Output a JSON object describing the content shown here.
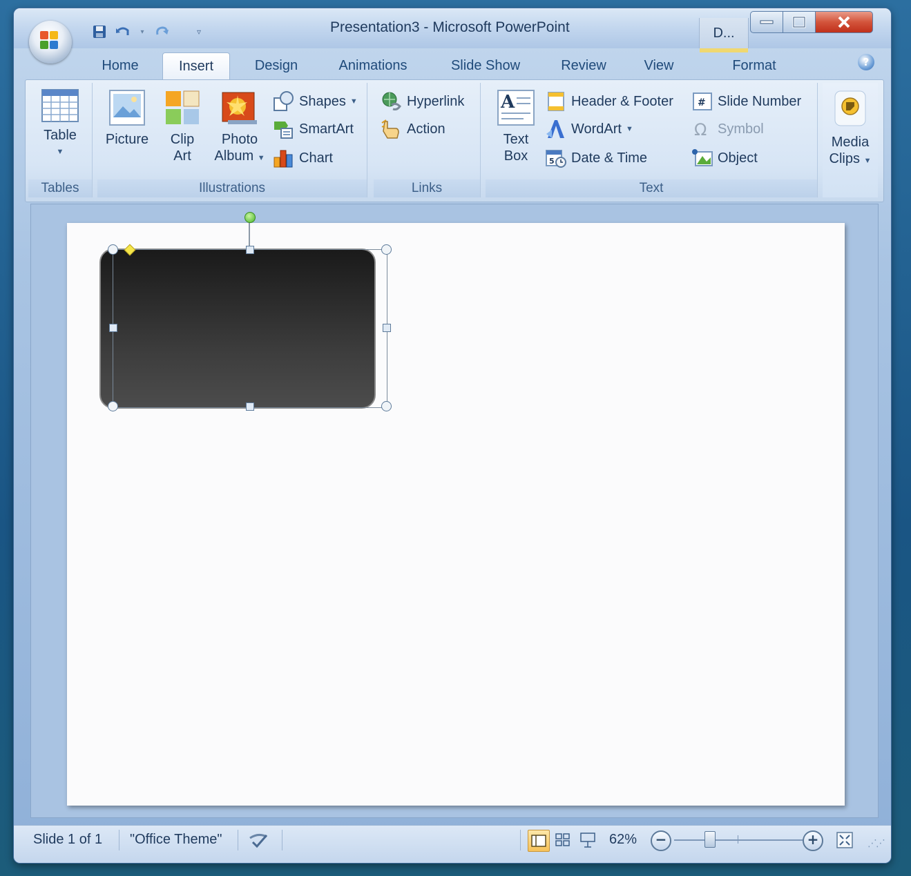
{
  "window": {
    "title": "Presentation3  -  Microsoft PowerPoint",
    "context_tab": "D...",
    "controls": {
      "minimize": "–",
      "maximize": "□",
      "close": "✕"
    }
  },
  "quick_access": [
    "save-icon",
    "undo-icon",
    "redo-icon",
    "customize-icon"
  ],
  "tabs": [
    {
      "label": "Home"
    },
    {
      "label": "Insert"
    },
    {
      "label": "Design"
    },
    {
      "label": "Animations"
    },
    {
      "label": "Slide Show"
    },
    {
      "label": "Review"
    },
    {
      "label": "View"
    },
    {
      "label": "Format"
    }
  ],
  "active_tab": "Insert",
  "ribbon": {
    "tables": {
      "label": "Tables",
      "table": "Table"
    },
    "illustrations": {
      "label": "Illustrations",
      "picture": "Picture",
      "clip_art_1": "Clip",
      "clip_art_2": "Art",
      "photo_album_1": "Photo",
      "photo_album_2": "Album",
      "shapes": "Shapes",
      "smartart": "SmartArt",
      "chart": "Chart"
    },
    "links": {
      "label": "Links",
      "hyperlink": "Hyperlink",
      "action": "Action"
    },
    "text": {
      "label": "Text",
      "text_box_1": "Text",
      "text_box_2": "Box",
      "header_footer": "Header & Footer",
      "wordart": "WordArt",
      "date_time": "Date & Time",
      "slide_number": "Slide Number",
      "symbol": "Symbol",
      "object": "Object"
    },
    "media": {
      "media_clips_1": "Media",
      "media_clips_2": "Clips"
    }
  },
  "slide": {
    "shape": "rounded-rectangle",
    "shape_fill_top": "#1a1a1a",
    "shape_fill_bottom": "#4c4c4c"
  },
  "status": {
    "slide_info": "Slide 1 of 1",
    "theme": "\"Office Theme\"",
    "zoom": "62%",
    "zoom_minus": "−",
    "zoom_plus": "+"
  },
  "colors": {
    "accent": "#1f3a5d",
    "close_button": "#c0301b",
    "active_view": "#f6c25a"
  }
}
